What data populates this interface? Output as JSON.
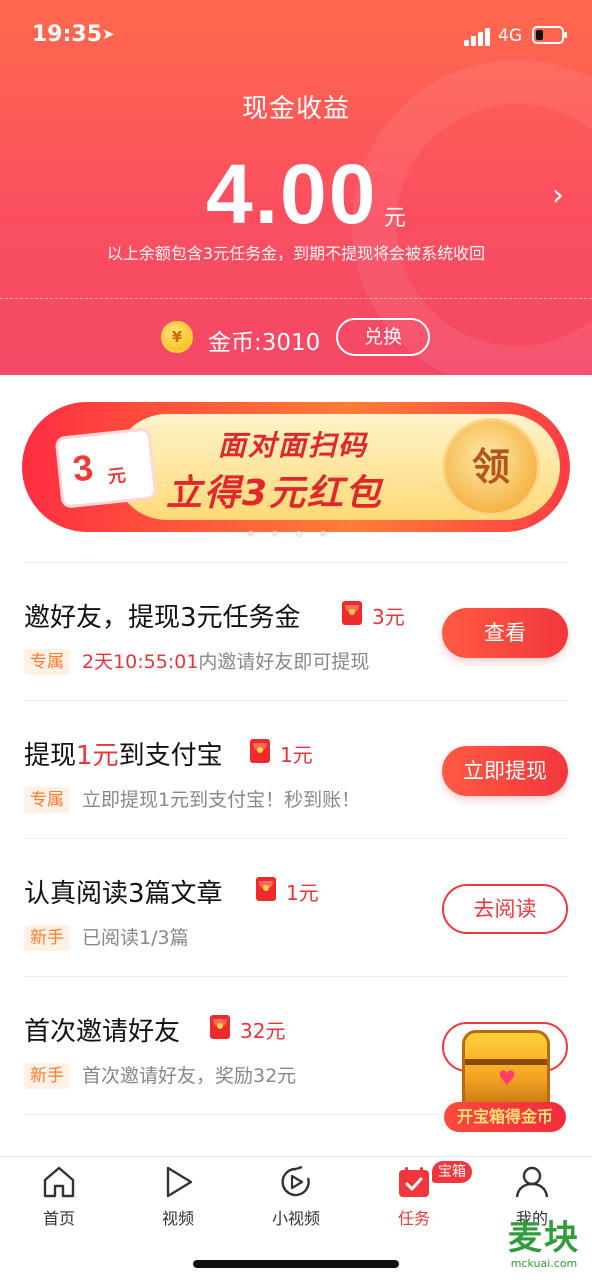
{
  "status_bar": {
    "time": "19:35",
    "network": "4G"
  },
  "header": {
    "title": "现金收益",
    "amount": "4.00",
    "unit": "元",
    "note": "以上余额包含3元任务金，到期不提现将会被系统收回",
    "coins_label": "金币:3010",
    "exchange_label": "兑换",
    "coin_glyph": "¥"
  },
  "banner": {
    "coupon_amount": "3",
    "coupon_unit": "元",
    "line1": "面对面扫码",
    "line2": "立得3元红包",
    "claim_label": "领",
    "page_count": 4,
    "active_page": 3
  },
  "tasks": [
    {
      "title": "邀好友，提现3元任务金",
      "reward": "3元",
      "tag": "专属",
      "desc_timer": "2天10:55:01",
      "desc": "内邀请好友即可提现",
      "button": "查看",
      "button_style": "solid"
    },
    {
      "title_prefix": "提现",
      "title_highlight": "1元",
      "title_suffix": "到支付宝",
      "reward": "1元",
      "tag": "专属",
      "desc": "立即提现1元到支付宝！秒到账！",
      "button": "立即提现",
      "button_style": "solid"
    },
    {
      "title": "认真阅读3篇文章",
      "reward": "1元",
      "tag": "新手",
      "desc": "已阅读1/3篇",
      "button": "去阅读",
      "button_style": "outline"
    },
    {
      "title": "首次邀请好友",
      "reward": "32元",
      "tag": "新手",
      "desc": "首次邀请好友，奖励32元",
      "button": "",
      "button_style": "none"
    }
  ],
  "chest": {
    "label": "开宝箱得金币"
  },
  "tabbar": {
    "tabs": [
      {
        "label": "首页",
        "icon": "home-icon"
      },
      {
        "label": "视频",
        "icon": "play-icon"
      },
      {
        "label": "小视频",
        "icon": "small-video-icon"
      },
      {
        "label": "任务",
        "icon": "task-icon",
        "active": true
      },
      {
        "label": "我的",
        "icon": "profile-icon"
      }
    ],
    "badge": "宝箱"
  },
  "watermark": {
    "big": "麦块",
    "small": "mckuai.com"
  },
  "colors": {
    "accent": "#f2373c",
    "header_top": "#ff6a4d",
    "header_bottom": "#f44866",
    "tag_bg": "#fff1e6",
    "tag_text": "#ff7b2e"
  }
}
